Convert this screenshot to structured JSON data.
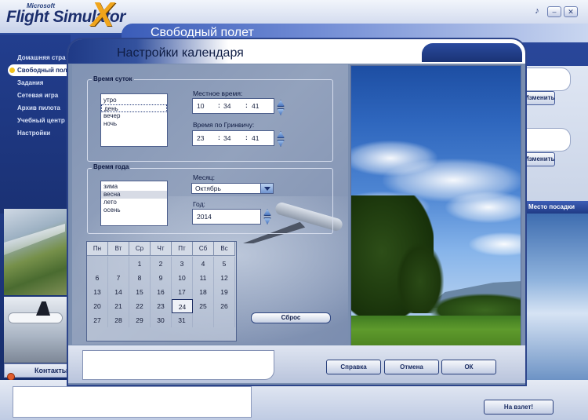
{
  "app": {
    "logo_small": "Microsoft",
    "logo_main": "Flight Simulator",
    "logo_x": "X",
    "background_page_title": "Свободный полет",
    "window_controls": {
      "sound": "♪",
      "minimize": "–",
      "close": "✕"
    }
  },
  "nav": {
    "items": [
      {
        "label": "Домашняя стра",
        "selected": false
      },
      {
        "label": "Свободный пол",
        "selected": true
      },
      {
        "label": "Задания",
        "selected": false
      },
      {
        "label": "Сетевая игра",
        "selected": false
      },
      {
        "label": "Архив пилота",
        "selected": false
      },
      {
        "label": "Учебный центр",
        "selected": false
      },
      {
        "label": "Настройки",
        "selected": false
      }
    ],
    "contacts_label": "Контакты"
  },
  "background_right": {
    "button1": "Изменить",
    "button2": "Изменить",
    "tab_label": "Место посадки"
  },
  "background_bottom": {
    "takeoff_button": "На взлет!"
  },
  "dialog": {
    "title": "Настройки календаря",
    "time_of_day": {
      "group_label": "Время суток",
      "options": [
        "утро",
        "день",
        "вечер",
        "ночь"
      ],
      "selected": "день",
      "local_time_label": "Местное время:",
      "local_time": {
        "hh": "10",
        "mm": "34",
        "ss": "41"
      },
      "gmt_label": "Время по Гринвичу:",
      "gmt_time": {
        "hh": "23",
        "mm": "34",
        "ss": "41"
      },
      "separator": ":"
    },
    "season": {
      "group_label": "Время года",
      "options": [
        "зима",
        "весна",
        "лето",
        "осень"
      ],
      "highlighted": "весна",
      "month_label": "Месяц:",
      "month_value": "Октябрь",
      "year_label": "Год:",
      "year_value": "2014"
    },
    "calendar": {
      "weekdays": [
        "Пн",
        "Вт",
        "Ср",
        "Чт",
        "Пт",
        "Сб",
        "Вс"
      ],
      "weeks": [
        [
          "",
          "",
          "1",
          "2",
          "3",
          "4",
          "5"
        ],
        [
          "6",
          "7",
          "8",
          "9",
          "10",
          "11",
          "12"
        ],
        [
          "13",
          "14",
          "15",
          "16",
          "17",
          "18",
          "19"
        ],
        [
          "20",
          "21",
          "22",
          "23",
          "24",
          "25",
          "26"
        ],
        [
          "27",
          "28",
          "29",
          "30",
          "31",
          "",
          ""
        ]
      ],
      "today": "24"
    },
    "reset_button": "Сброс",
    "help_button": "Справка",
    "cancel_button": "Отмена",
    "ok_button": "ОК"
  }
}
